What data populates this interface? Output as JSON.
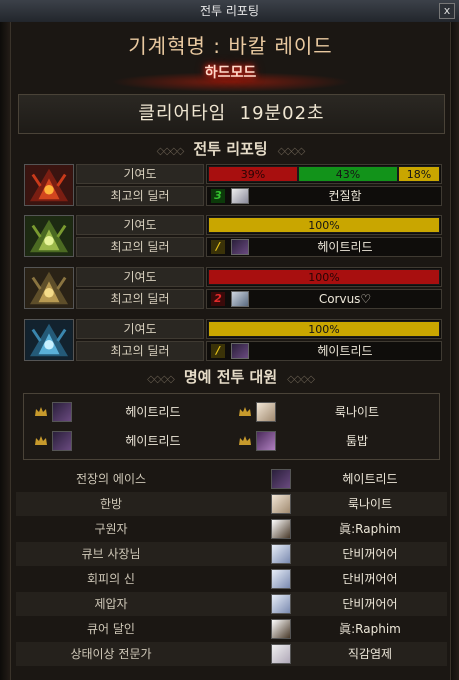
{
  "window": {
    "title": "전투 리포팅",
    "close_label": "x"
  },
  "raid": {
    "title": "기계혁명 : 바칼 레이드",
    "subtitle": "하드모드"
  },
  "clear_time": {
    "label": "클리어타임",
    "value": "19분02초"
  },
  "report_header": "전투 리포팅",
  "honor_header": "명예 전투 대원",
  "labels": {
    "contribution": "기여도",
    "best_dealer": "최고의 딜러"
  },
  "bosses": [
    {
      "icon": "red-dragon-icon",
      "contribution": [
        {
          "percent": 39,
          "label": "39%",
          "color": "#a80f0f"
        },
        {
          "percent": 43,
          "label": "43%",
          "color": "#12931a"
        },
        {
          "percent": 18,
          "label": "18%",
          "color": "#c9a600"
        }
      ],
      "dealer": {
        "rank": "3",
        "rank_color": "#35c22f",
        "name": "컨질함"
      }
    },
    {
      "icon": "green-dragon-icon",
      "contribution": [
        {
          "percent": 100,
          "label": "100%",
          "color": "#c9a600"
        }
      ],
      "dealer": {
        "rank": "/",
        "rank_color": "#e6c21a",
        "name": "헤이트리드"
      }
    },
    {
      "icon": "gold-dragon-icon",
      "contribution": [
        {
          "percent": 100,
          "label": "100%",
          "color": "#a80f0f"
        }
      ],
      "dealer": {
        "rank": "2",
        "rank_color": "#e02a2a",
        "name": "Corvus♡"
      }
    },
    {
      "icon": "blue-dragon-icon",
      "contribution": [
        {
          "percent": 100,
          "label": "100%",
          "color": "#c9a600"
        }
      ],
      "dealer": {
        "rank": "/",
        "rank_color": "#e6c21a",
        "name": "헤이트리드"
      }
    }
  ],
  "honor": [
    {
      "name": "헤이트리드"
    },
    {
      "name": "룩나이트"
    },
    {
      "name": "헤이트리드"
    },
    {
      "name": "툼밥"
    }
  ],
  "awards": [
    {
      "title": "전장의 에이스",
      "name": "헤이트리드"
    },
    {
      "title": "한방",
      "name": "룩나이트"
    },
    {
      "title": "구원자",
      "name": "眞:Raphim"
    },
    {
      "title": "큐브 사장님",
      "name": "단비꺼어어"
    },
    {
      "title": "회피의 신",
      "name": "단비꺼어어"
    },
    {
      "title": "제압자",
      "name": "단비꺼어어"
    },
    {
      "title": "큐어 달인",
      "name": "眞:Raphim"
    },
    {
      "title": "상태이상 전문가",
      "name": "직감염제"
    }
  ]
}
